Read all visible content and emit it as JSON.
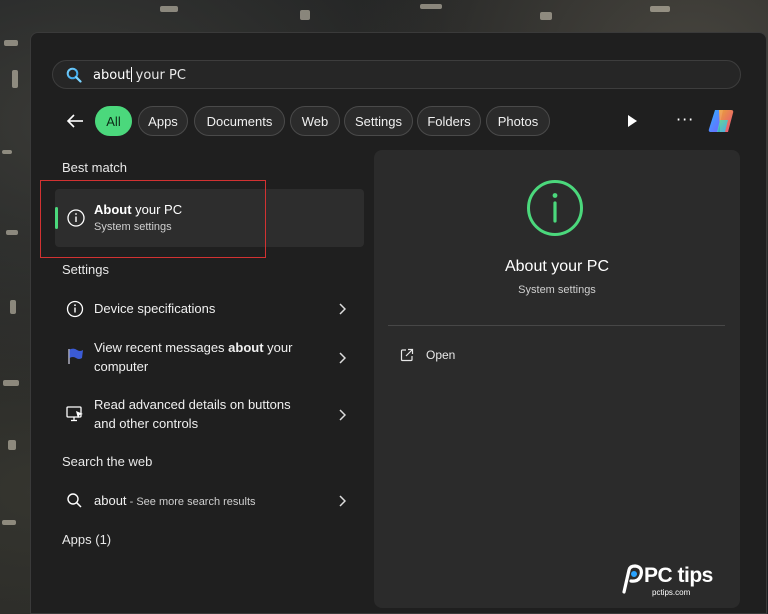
{
  "search": {
    "query_typed": "about",
    "query_rest": " your PC"
  },
  "filters": [
    "All",
    "Apps",
    "Documents",
    "Web",
    "Settings",
    "Folders",
    "Photos"
  ],
  "active_filter": "All",
  "sections": {
    "best_match": "Best match",
    "settings": "Settings",
    "search_web": "Search the web",
    "apps": "Apps (1)"
  },
  "best_match": {
    "title_bold": "About",
    "title_rest": " your PC",
    "subtitle": "System settings",
    "icon": "info-icon"
  },
  "settings_items": [
    {
      "text": "Device specifications",
      "icon": "info-icon"
    },
    {
      "text_pre": "View recent messages ",
      "text_bold": "about",
      "text_post": " your",
      "text_line2": "computer",
      "icon": "flag-icon"
    },
    {
      "text_line1": "Read advanced details on buttons",
      "text_line2": "and other controls",
      "icon": "monitor-cursor-icon"
    }
  ],
  "web_item": {
    "query": "about",
    "sep": " - ",
    "hint": "See more search results",
    "icon": "search-icon"
  },
  "preview": {
    "title": "About your PC",
    "subtitle": "System settings",
    "action": "Open"
  },
  "watermark": {
    "brand": "PC tips",
    "domain": "pctips.com"
  },
  "colors": {
    "accent": "#4bd87c",
    "highlight_box": "#d23232"
  }
}
